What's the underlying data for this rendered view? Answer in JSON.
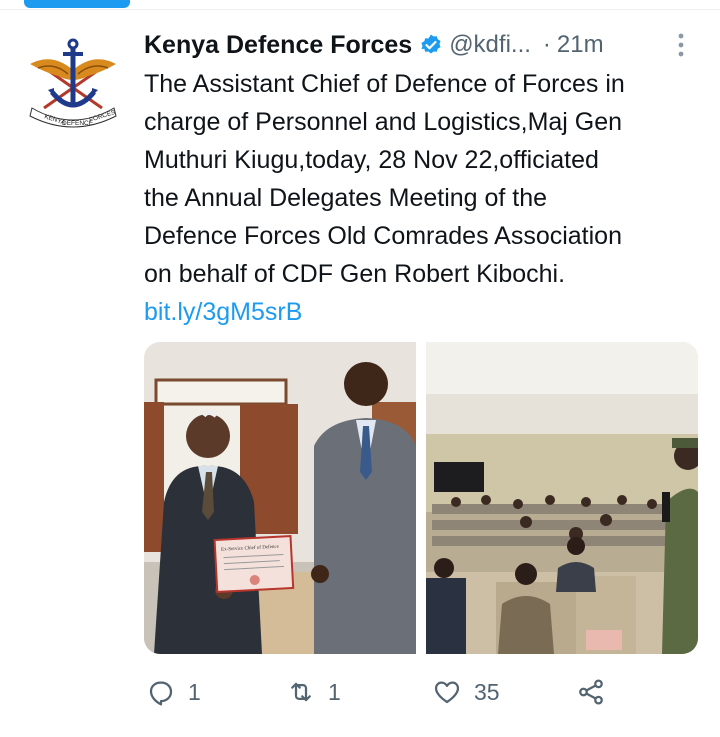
{
  "tweet": {
    "author_name": "Kenya Defence Forces",
    "handle": "@kdfi...",
    "separator": "·",
    "time": "21m",
    "text_lines": [
      "The Assistant Chief of Defence of Forces in",
      "charge of Personnel and Logistics,Maj Gen",
      "Muthuri Kiugu,today, 28 Nov 22,officiated",
      "the Annual Delegates Meeting of the",
      "Defence Forces Old Comrades Association",
      "on behalf of CDF Gen Robert Kibochi."
    ],
    "link": "bit.ly/3gM5srB",
    "avatar_logo_text": "KENYA DEFENCE FORCES",
    "media": [
      {
        "description_icon": "photo",
        "certificate_title": "Ex-Service Chief of Defence"
      },
      {
        "description_icon": "photo"
      }
    ]
  },
  "actions": {
    "reply_count": "1",
    "retweet_count": "1",
    "like_count": "35",
    "icons": [
      "reply-icon",
      "retweet-icon",
      "like-icon",
      "share-icon"
    ]
  },
  "colors": {
    "accent": "#1d9bf0",
    "secondary_text": "#536471"
  }
}
